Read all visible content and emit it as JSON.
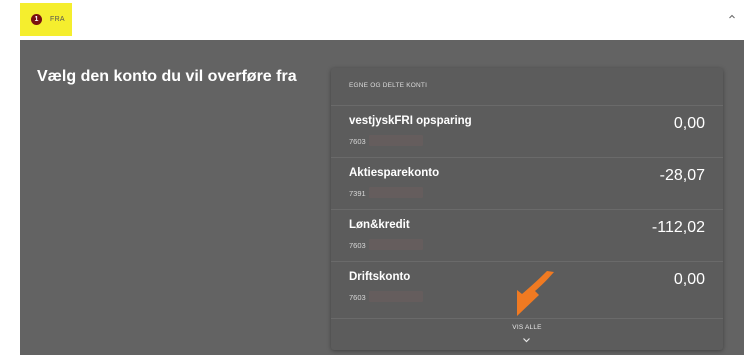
{
  "step": {
    "number": "1",
    "label": "FRA"
  },
  "heading": "Vælg den konto du vil overføre fra",
  "accounts_panel": {
    "section_title": "EGNE OG DELTE KONTI",
    "accounts": [
      {
        "name": "vestjyskFRI opsparing",
        "number": "7603",
        "balance": "0,00"
      },
      {
        "name": "Aktiesparekonto",
        "number": "7391",
        "balance": "-28,07"
      },
      {
        "name": "Løn&kredit",
        "number": "7603",
        "balance": "-112,02"
      },
      {
        "name": "Driftskonto",
        "number": "7603",
        "balance": "0,00"
      }
    ],
    "show_all_label": "VIS ALLE"
  },
  "icons": {
    "collapse": "chevron-up-icon",
    "show_all": "chevron-down-icon",
    "annotation": "arrow-annotation-icon"
  },
  "colors": {
    "highlight": "#f5ee2e",
    "step_badge": "#7a1010",
    "overlay": "#636363",
    "card": "#5c5c5c",
    "annotation_arrow": "#f07a22"
  }
}
